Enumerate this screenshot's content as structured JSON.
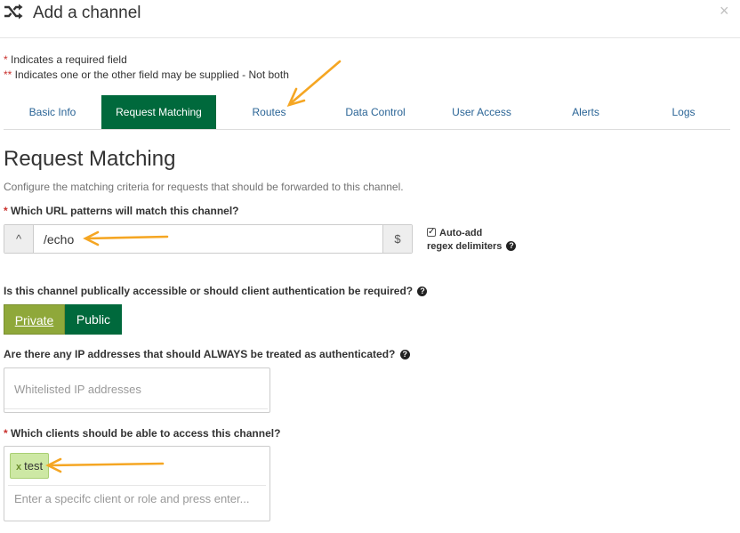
{
  "header": {
    "title": "Add a channel",
    "icon": "shuffle-icon",
    "close_label": "×"
  },
  "notes": {
    "required_marker": "*",
    "required_text": " Indicates a required field",
    "either_marker": "**",
    "either_text": " Indicates one or the other field may be supplied - Not both"
  },
  "tabs": [
    {
      "label": "Basic Info",
      "active": false
    },
    {
      "label": "Request Matching",
      "active": true
    },
    {
      "label": "Routes",
      "active": false
    },
    {
      "label": "Data Control",
      "active": false
    },
    {
      "label": "User Access",
      "active": false
    },
    {
      "label": "Alerts",
      "active": false
    },
    {
      "label": "Logs",
      "active": false
    }
  ],
  "section": {
    "title": "Request Matching",
    "description": "Configure the matching criteria for requests that should be forwarded to this channel."
  },
  "url_patterns": {
    "marker": "*",
    "label": " Which URL patterns will match this channel?",
    "prefix": "^",
    "value": "/echo",
    "suffix": "$",
    "autoadd_line1": "Auto-add",
    "autoadd_line2": "regex delimiters",
    "autoadd_checked": true
  },
  "auth": {
    "label": "Is this channel publically accessible or should client authentication be required?",
    "options": [
      "Private",
      "Public"
    ],
    "selected": "Private"
  },
  "whitelist": {
    "label": "Are there any IP addresses that should ALWAYS be treated as authenticated?",
    "placeholder": "Whitelisted IP addresses"
  },
  "clients": {
    "marker": "*",
    "label": " Which clients should be able to access this channel?",
    "chips": [
      {
        "remove": "x",
        "label": "test"
      }
    ],
    "placeholder": "Enter a specifc client or role and press enter..."
  },
  "colors": {
    "accent": "#00693c",
    "private_button": "#8fa83a",
    "chip_bg": "#cde8a4",
    "link": "#2a6496",
    "annotation_arrow": "#f5a623"
  }
}
